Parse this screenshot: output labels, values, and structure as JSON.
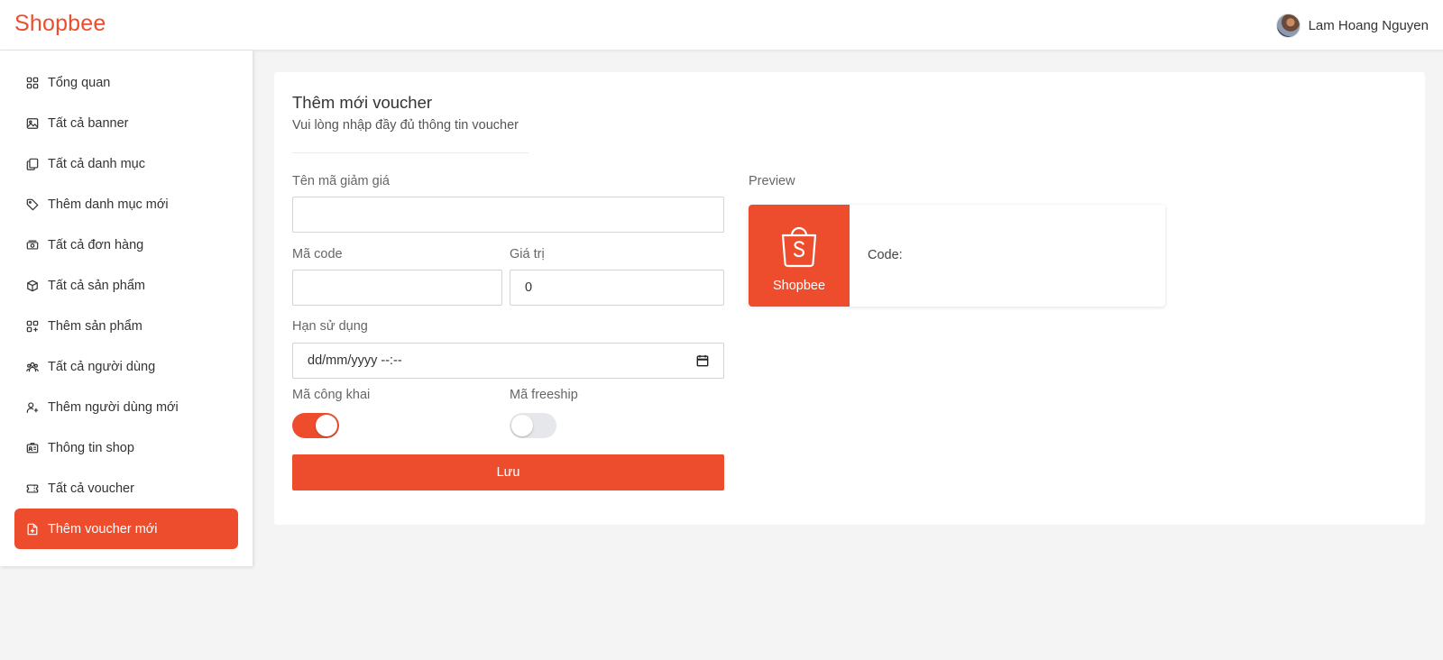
{
  "app": {
    "logo": "Shopbee",
    "brand_color": "#ee4d2d"
  },
  "user": {
    "name": "Lam Hoang Nguyen"
  },
  "sidebar": {
    "items": [
      {
        "label": "Tổng quan",
        "icon": "grid-icon",
        "active": false
      },
      {
        "label": "Tất cả banner",
        "icon": "image-icon",
        "active": false
      },
      {
        "label": "Tất cả danh mục",
        "icon": "copy-icon",
        "active": false
      },
      {
        "label": "Thêm danh mục mới",
        "icon": "tag-icon",
        "active": false
      },
      {
        "label": "Tất cả đơn hàng",
        "icon": "cash-icon",
        "active": false
      },
      {
        "label": "Tất cả sản phẩm",
        "icon": "box-icon",
        "active": false
      },
      {
        "label": "Thêm sản phẩm",
        "icon": "grid-plus-icon",
        "active": false
      },
      {
        "label": "Tất cả người dùng",
        "icon": "users-icon",
        "active": false
      },
      {
        "label": "Thêm người dùng mới",
        "icon": "user-plus-icon",
        "active": false
      },
      {
        "label": "Thông tin shop",
        "icon": "id-card-icon",
        "active": false
      },
      {
        "label": "Tất cả voucher",
        "icon": "ticket-icon",
        "active": false
      },
      {
        "label": "Thêm voucher mới",
        "icon": "file-plus-icon",
        "active": true
      }
    ]
  },
  "form": {
    "title": "Thêm mới voucher",
    "subtitle": "Vui lòng nhập đầy đủ thông tin voucher",
    "name_label": "Tên mã giảm giá",
    "name_value": "",
    "code_label": "Mã code",
    "code_value": "",
    "value_label": "Giá trị",
    "value_value": "0",
    "expiry_label": "Hạn sử dụng",
    "expiry_value": "dd/mm/yyyy --:--",
    "public_label": "Mã công khai",
    "public_on": true,
    "freeship_label": "Mã freeship",
    "freeship_on": false,
    "save_label": "Lưu"
  },
  "preview": {
    "label": "Preview",
    "brand": "Shopbee",
    "code_label": "Code:"
  }
}
